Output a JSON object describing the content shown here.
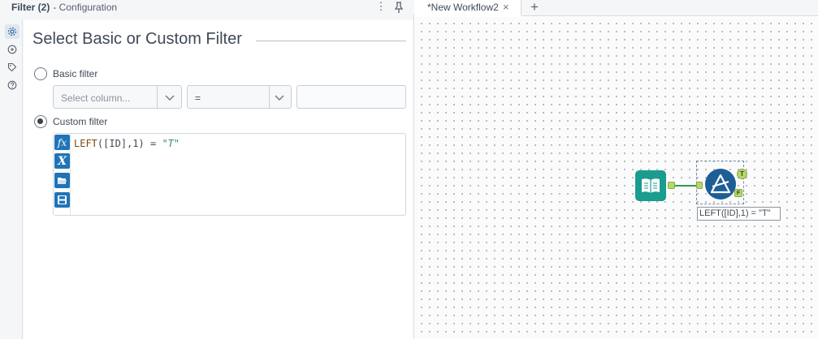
{
  "config": {
    "title": "Filter (2)",
    "subtitle": "- Configuration",
    "more_icon": "⋮",
    "section_title": "Select Basic or Custom Filter",
    "basic_label": "Basic filter",
    "custom_label": "Custom filter",
    "selected_mode": "custom",
    "column_placeholder": "Select column...",
    "operator_value": "=",
    "value_input": "",
    "expression": {
      "fn": "LEFT",
      "open": "(",
      "field": "[ID]",
      "comma": ",",
      "num": "1",
      "close": ")",
      "op": " = ",
      "str": "\"T\""
    },
    "toolbar_icons": [
      "functions-icon",
      "variables-icon",
      "open-icon",
      "save-icon"
    ],
    "rail_icons": [
      "settings-icon",
      "annotation-icon",
      "tag-icon",
      "help-icon"
    ]
  },
  "workflow": {
    "tab_label": "*New Workflow2",
    "tab_close": "×",
    "tab_add": "+",
    "filter_annotation": "LEFT([ID],1) = \"T\"",
    "anchor_true": "T",
    "anchor_false": "F"
  },
  "colors": {
    "input_tool": "#1a9c8e",
    "filter_tool": "#1d5e96",
    "anchor": "#b6d66a",
    "accent": "#1f74b8"
  }
}
